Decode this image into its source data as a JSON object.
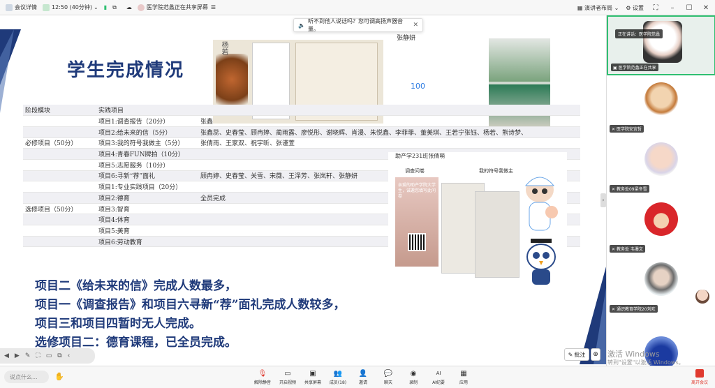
{
  "topbar": {
    "meeting_info": "会议详情",
    "time": "12:50 (40分钟)",
    "screen_share_status": "医学院范蠡正在共享屏幕",
    "speaker_layout": "演讲者布局",
    "settings": "设置"
  },
  "notice": {
    "text": "听不到他人说话吗？您可调高扬声器音量。"
  },
  "slide": {
    "title": "学生完成情况",
    "table_header": [
      "阶段模块",
      "实践项目",
      ""
    ],
    "rows": [
      [
        "",
        "项目1:调查报告（20分）",
        "张鑫"
      ],
      [
        "",
        "项目2:给未来的信（5分）",
        "张鑫蕊、史春莹、顾冉婷、蔺雨露、廖悦彤、谢晓辉、肖漫、朱悦鑫、李菲菲、董美琪、王若宁张钰、杨若、熊诗梦、"
      ],
      [
        "必修项目（50分）",
        "项目3:我的符号我做主（5分）",
        "张倩雨、王家双、祝宇昕、张谨萱"
      ],
      [
        "",
        "项目4:青春FUN牌拍（10分）",
        ""
      ],
      [
        "",
        "项目5:志愿服务（10分）",
        ""
      ],
      [
        "",
        "项目6:寻新“荐”面礼",
        "顾冉婷、史春莹、关雪、宋薇、王泽芳、张岚轩、张静妍"
      ],
      [
        "",
        "项目1:专业实践项目（20分）",
        ""
      ],
      [
        "",
        "项目2:德育",
        "全员完成"
      ],
      [
        "选修项目（50分）",
        "项目3:智育",
        ""
      ],
      [
        "",
        "项目4:体育",
        ""
      ],
      [
        "",
        "项目5:美育",
        ""
      ],
      [
        "",
        "项目6:劳动教育",
        ""
      ]
    ],
    "summary": [
      "项目二《给未来的信》完成人数最多，",
      "项目一《调查报告》和项目六寻新“荐”面礼完成人数较多，",
      "项目三和项目四暂时无人完成。",
      "选修项目二：德育课程，已全员完成。"
    ],
    "photo1_name": "杨若",
    "photo2_name": "张静妍",
    "photo2_value": "100",
    "collage_title": "助产学231班张倩萌",
    "collage_sub1": "调查问卷",
    "collage_sub2": "我的符号我做主",
    "collage_card_text": "亲爱的助产学院大学生，诚邀您填写此问卷"
  },
  "participants": [
    {
      "name": "医学院范蠡正在共享",
      "note": "正在讲话：医学院范蠡"
    },
    {
      "name": "医学院安宜哲"
    },
    {
      "name": "教务处09梁冬雪"
    },
    {
      "name": "教务处 韦瀑文"
    },
    {
      "name": "通识教育学院20刘欢"
    },
    {
      "name": ""
    }
  ],
  "annotation": {
    "comment_label": "批注",
    "watermark_line1": "激活 Windows",
    "watermark_line2": "转到\"设置\"以激活 Windows。"
  },
  "bottombar": {
    "chat_placeholder": "说点什么...",
    "tools": [
      {
        "icon": "mic-off-icon",
        "label": "解除静音"
      },
      {
        "icon": "video-icon",
        "label": "开启视频"
      },
      {
        "icon": "share-screen-icon",
        "label": "共享屏幕"
      },
      {
        "icon": "members-icon",
        "label": "成员(18)"
      },
      {
        "icon": "invite-icon",
        "label": "邀请"
      },
      {
        "icon": "chat-icon",
        "label": "聊天"
      },
      {
        "icon": "record-icon",
        "label": "录制"
      },
      {
        "icon": "ai-icon",
        "label": "AI纪要"
      },
      {
        "icon": "apps-icon",
        "label": "应用"
      }
    ],
    "leave_label": "离开会议"
  },
  "colors": {
    "title_blue": "#1f3a7a",
    "active_green": "#2fbf71",
    "leave_red": "#e03a2f"
  }
}
